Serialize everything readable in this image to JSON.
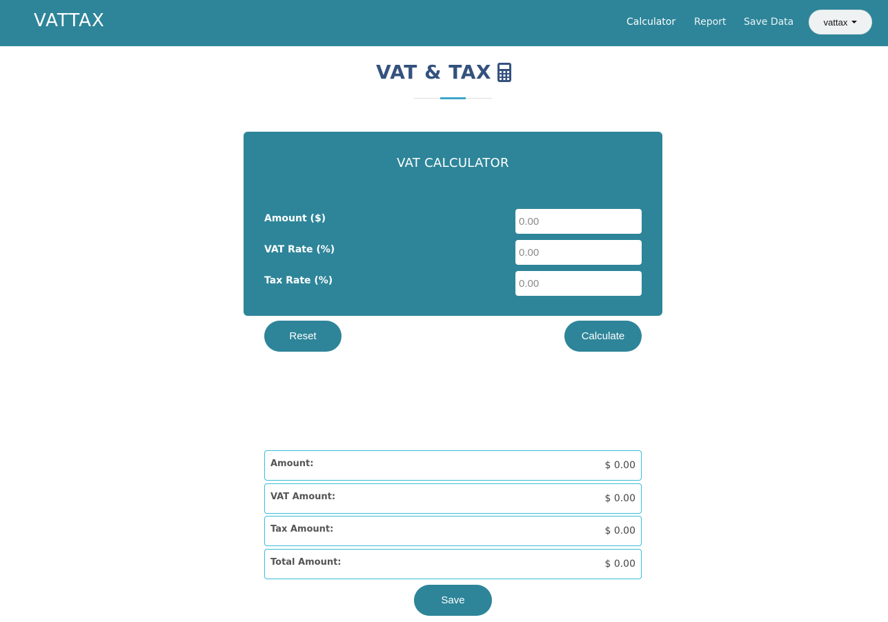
{
  "navbar": {
    "brand": "VATTAX",
    "links": [
      "Calculator",
      "Report",
      "Save Data"
    ],
    "user_menu": "vattax"
  },
  "page": {
    "title": "VAT & TAX",
    "title_icon": "calculator-icon"
  },
  "calculator": {
    "title": "VAT CALCULATOR",
    "fields": [
      {
        "label": "Amount ($)",
        "placeholder": "0.00",
        "value": ""
      },
      {
        "label": "VAT Rate (%)",
        "placeholder": "0.00",
        "value": ""
      },
      {
        "label": "Tax Rate (%)",
        "placeholder": "0.00",
        "value": ""
      }
    ],
    "reset_label": "Reset",
    "calculate_label": "Calculate"
  },
  "results": [
    {
      "label": "Amount:",
      "value": "$ 0.00"
    },
    {
      "label": "VAT Amount:",
      "value": "$ 0.00"
    },
    {
      "label": "Tax Amount:",
      "value": "$ 0.00"
    },
    {
      "label": "Total Amount:",
      "value": "$ 0.00"
    }
  ],
  "save_label": "Save",
  "colors": {
    "primary": "#2e8599",
    "title": "#34527e",
    "accent": "#3ba7c9",
    "result_border": "#39bcd6"
  }
}
